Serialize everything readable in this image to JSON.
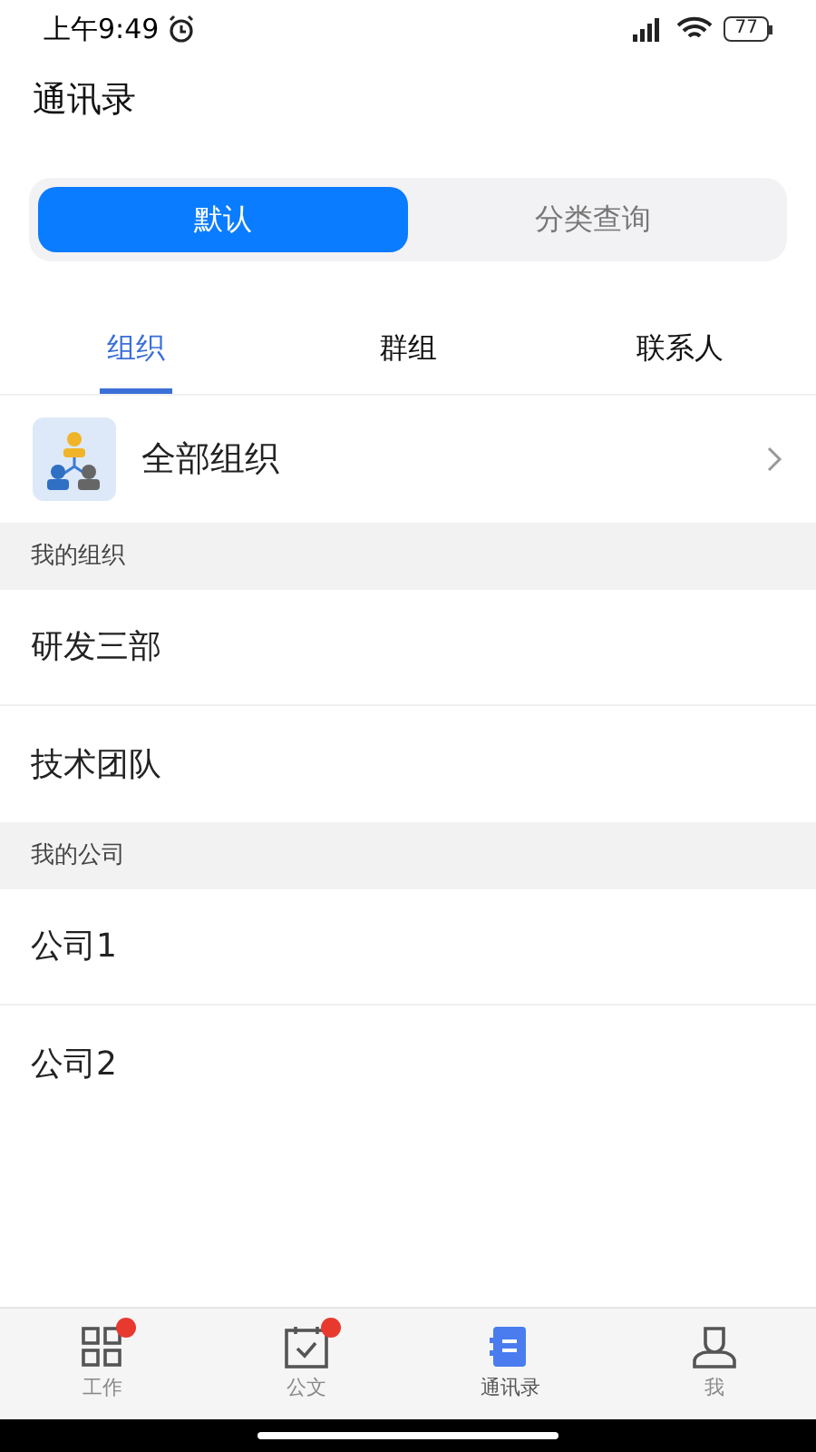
{
  "status_bar": {
    "time": "上午9:49",
    "battery": "77"
  },
  "title": "通讯录",
  "segments": [
    {
      "label": "默认",
      "selected": true
    },
    {
      "label": "分类查询",
      "selected": false
    }
  ],
  "tabs": [
    {
      "label": "组织",
      "selected": true
    },
    {
      "label": "群组",
      "selected": false
    },
    {
      "label": "联系人",
      "selected": false
    }
  ],
  "all_orgs": {
    "label": "全部组织"
  },
  "sections": [
    {
      "header": "我的组织",
      "items": [
        "研发三部",
        "技术团队"
      ]
    },
    {
      "header": "我的公司",
      "items": [
        "公司1",
        "公司2"
      ]
    }
  ],
  "nav": [
    {
      "kind": "grid",
      "label": "工作",
      "badge": true,
      "selected": false
    },
    {
      "kind": "calendar",
      "label": "公文",
      "badge": true,
      "selected": false
    },
    {
      "kind": "book",
      "label": "通讯录",
      "badge": false,
      "selected": true
    },
    {
      "kind": "person",
      "label": "我",
      "badge": false,
      "selected": false
    }
  ]
}
